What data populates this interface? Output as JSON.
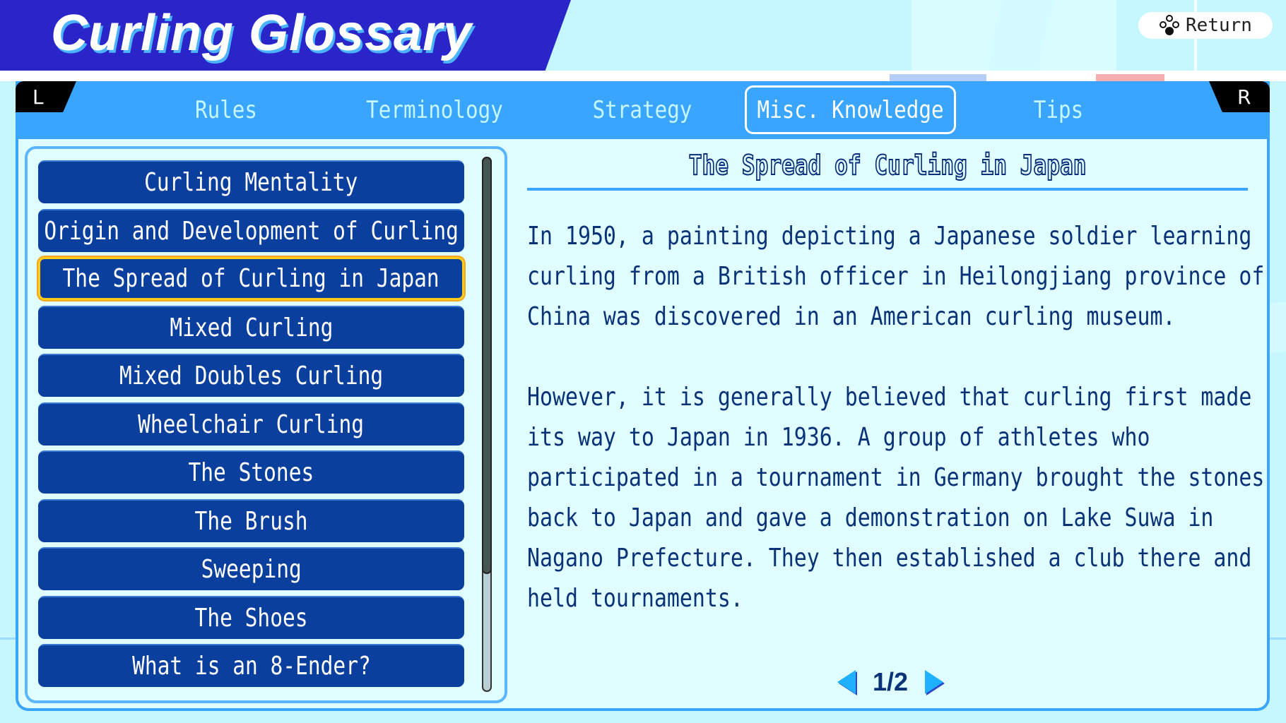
{
  "header": {
    "title": "Curling Glossary",
    "return_label": "Return",
    "return_icon": "button-cluster-icon"
  },
  "shoulders": {
    "left": "L",
    "right": "R"
  },
  "tabs": [
    {
      "label": "Rules",
      "active": false
    },
    {
      "label": "Terminology",
      "active": false
    },
    {
      "label": "Strategy",
      "active": false
    },
    {
      "label": "Misc. Knowledge",
      "active": true
    },
    {
      "label": "Tips",
      "active": false
    }
  ],
  "list": {
    "items": [
      {
        "label": "Curling Mentality"
      },
      {
        "label": "Origin and Development of Curling"
      },
      {
        "label": "The Spread of Curling in Japan",
        "selected": true
      },
      {
        "label": "Mixed Curling"
      },
      {
        "label": "Mixed Doubles Curling"
      },
      {
        "label": "Wheelchair Curling"
      },
      {
        "label": "The Stones"
      },
      {
        "label": "The Brush"
      },
      {
        "label": "Sweeping"
      },
      {
        "label": "The Shoes"
      },
      {
        "label": "What is an 8-Ender?"
      }
    ],
    "scroll_fraction_visible": 0.78
  },
  "article": {
    "title": "The Spread of Curling in Japan",
    "paragraphs": [
      "In 1950, a painting depicting a Japanese soldier learning curling from a British officer in Heilongjiang province of China was discovered in an American curling museum.",
      "However, it is generally believed that curling first made its way to Japan in 1936. A group of athletes who participated in a tournament in Germany brought the stones back to Japan and gave a demonstration on Lake Suwa in Nagano Prefecture. They then established a club there and held tournaments."
    ],
    "page_label": "1/2",
    "current_page": 1,
    "total_pages": 2
  },
  "colors": {
    "header_bg": "#2a25c8",
    "tab_bar": "#3aa5ff",
    "list_button": "#0a3f9e",
    "selection_border": "#ffcc1a",
    "body_text": "#0a3278",
    "content_bg": "#e0feff"
  }
}
